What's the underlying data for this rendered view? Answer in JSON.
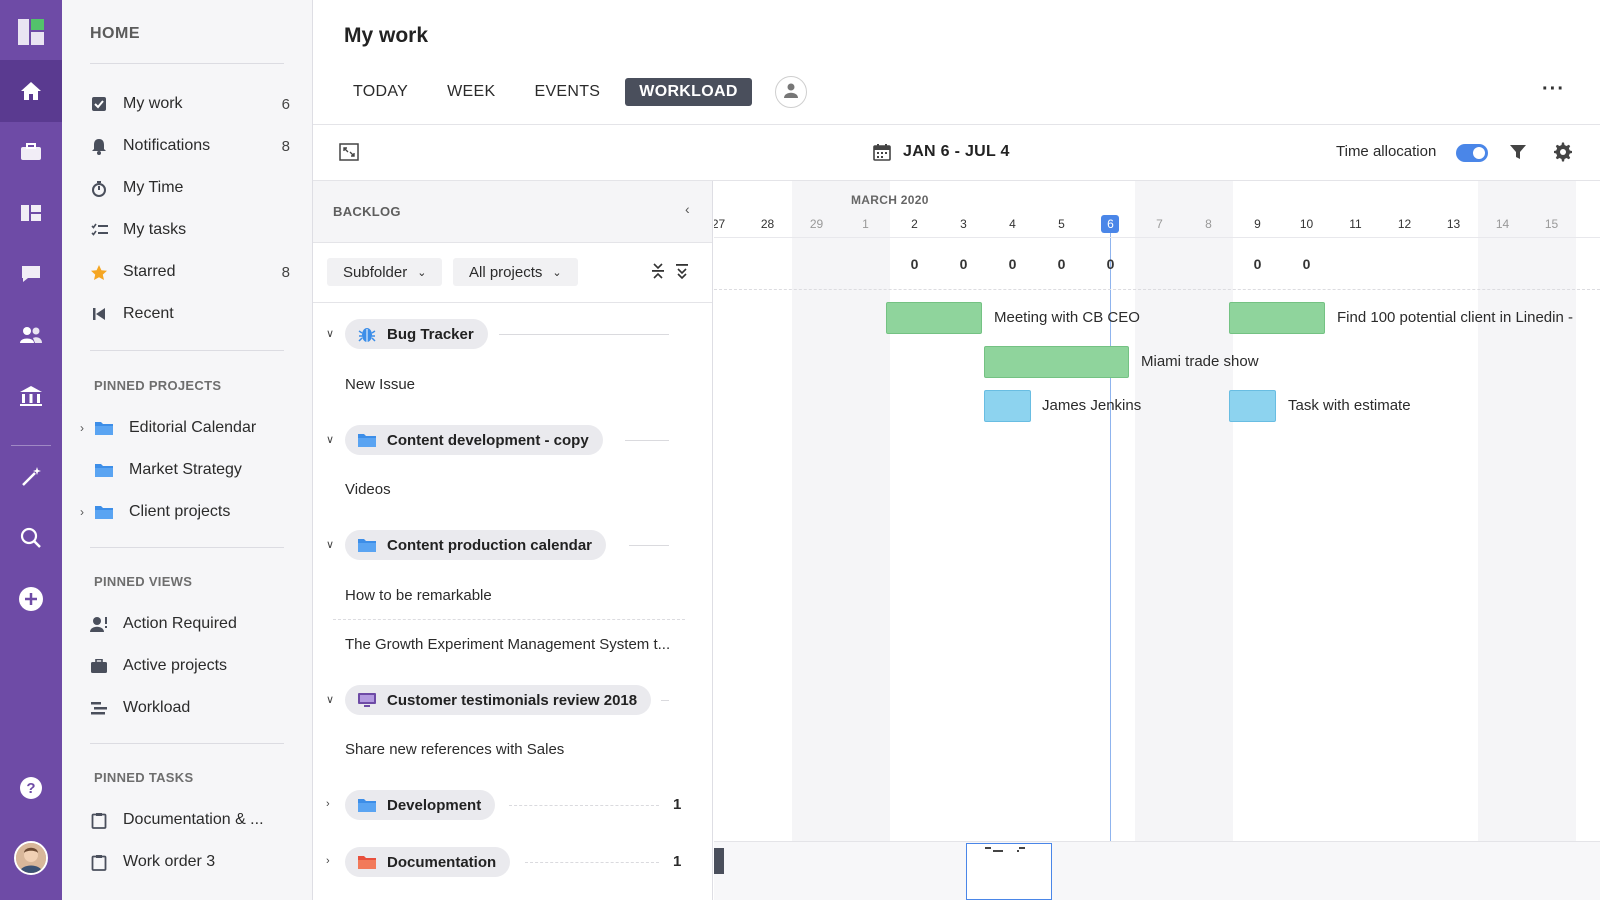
{
  "rail": {
    "items": [
      "logo-icon",
      "home-icon",
      "briefcase-icon",
      "dashboard-icon",
      "chat-icon",
      "team-icon",
      "bank-icon",
      "magic-wand-icon",
      "search-icon",
      "add-icon",
      "help-icon",
      "avatar"
    ]
  },
  "home": {
    "title": "HOME",
    "items": [
      {
        "label": "My work",
        "count": "6"
      },
      {
        "label": "Notifications",
        "count": "8"
      },
      {
        "label": "My Time",
        "count": ""
      },
      {
        "label": "My tasks",
        "count": ""
      },
      {
        "label": "Starred",
        "count": "8"
      },
      {
        "label": "Recent",
        "count": ""
      }
    ],
    "pinned_projects_title": "PINNED PROJECTS",
    "pinned_projects": [
      "Editorial Calendar",
      "Market Strategy",
      "Client projects"
    ],
    "pinned_views_title": "PINNED VIEWS",
    "pinned_views": [
      "Action Required",
      "Active projects",
      "Workload"
    ],
    "pinned_tasks_title": "PINNED TASKS",
    "pinned_tasks": [
      "Documentation & ...",
      "Work order 3"
    ]
  },
  "main": {
    "title": "My work",
    "tabs": [
      "TODAY",
      "WEEK",
      "EVENTS",
      "WORKLOAD"
    ],
    "active_tab": "WORKLOAD",
    "more": "···",
    "date_range": "JAN 6 - JUL 4",
    "time_allocation_label": "Time allocation",
    "time_allocation_on": true
  },
  "backlog": {
    "title": "BACKLOG",
    "subfolder_label": "Subfolder",
    "projects_label": "All projects",
    "groups": [
      {
        "name": "Bug Tracker",
        "tasks": [
          "New Issue"
        ],
        "count": ""
      },
      {
        "name": "Content development - copy",
        "tasks": [
          "Videos"
        ],
        "count": ""
      },
      {
        "name": "Content production calendar",
        "tasks": [
          "How to be remarkable",
          "The Growth Experiment Management System t..."
        ],
        "count": ""
      },
      {
        "name": "Customer testimonials review 2018",
        "tasks": [
          "Share new references with Sales"
        ],
        "count": ""
      },
      {
        "name": "Development",
        "tasks": [],
        "count": "1"
      },
      {
        "name": "Documentation",
        "tasks": [],
        "count": "1"
      }
    ]
  },
  "timeline": {
    "month": "MARCH 2020",
    "days": [
      "27",
      "28",
      "29",
      "1",
      "2",
      "3",
      "4",
      "5",
      "6",
      "7",
      "8",
      "9",
      "10",
      "11",
      "12",
      "13",
      "14",
      "15"
    ],
    "today": "6",
    "allocation": [
      "",
      "",
      "",
      "",
      "0",
      "0",
      "0",
      "0",
      "0",
      "",
      "",
      "0",
      "0",
      "",
      "",
      "",
      "",
      ""
    ],
    "bars": [
      {
        "label": "Meeting with CB CEO",
        "color": "#8fd49c"
      },
      {
        "label": "Find 100 potential client in Linedin -",
        "color": "#8fd49c"
      },
      {
        "label": "Miami trade show",
        "color": "#8fd49c"
      },
      {
        "label": "James Jenkins",
        "color": "#8dd3ef"
      },
      {
        "label": "Task with estimate",
        "color": "#8dd3ef"
      }
    ]
  }
}
